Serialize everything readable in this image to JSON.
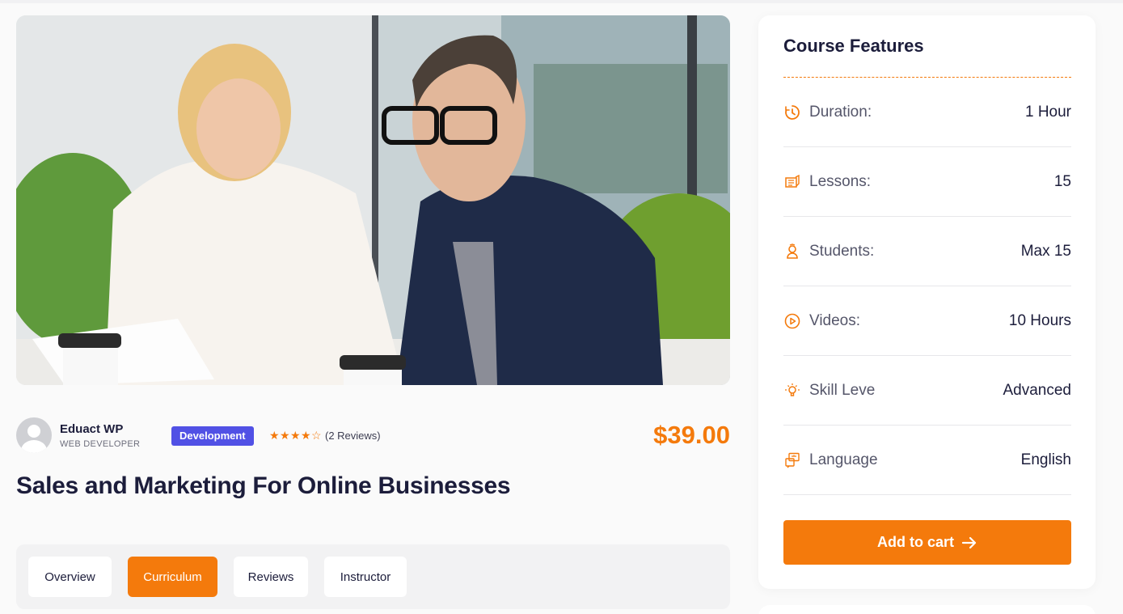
{
  "course": {
    "author_name": "Eduact WP",
    "author_role": "WEB DEVELOPER",
    "category": "Development",
    "rating": 4,
    "rating_max": 5,
    "reviews_text": "(2 Reviews)",
    "price": "$39.00",
    "title": "Sales and Marketing For Online Businesses"
  },
  "tabs": [
    {
      "label": "Overview",
      "active": false
    },
    {
      "label": "Curriculum",
      "active": true
    },
    {
      "label": "Reviews",
      "active": false
    },
    {
      "label": "Instructor",
      "active": false
    }
  ],
  "features": {
    "title": "Course Features",
    "items": [
      {
        "icon": "clock-icon",
        "label": "Duration:",
        "value": "1 Hour"
      },
      {
        "icon": "book-icon",
        "label": "Lessons:",
        "value": "15"
      },
      {
        "icon": "student-icon",
        "label": "Students:",
        "value": "Max 15"
      },
      {
        "icon": "play-icon",
        "label": "Videos:",
        "value": "10 Hours"
      },
      {
        "icon": "lightbulb-icon",
        "label": "Skill Leve",
        "value": "Advanced"
      },
      {
        "icon": "language-icon",
        "label": "Language",
        "value": "English"
      }
    ],
    "cart_label": "Add to cart"
  },
  "colors": {
    "accent": "#f47a0c",
    "badge": "#5151e5",
    "heading": "#1c1d3b"
  }
}
